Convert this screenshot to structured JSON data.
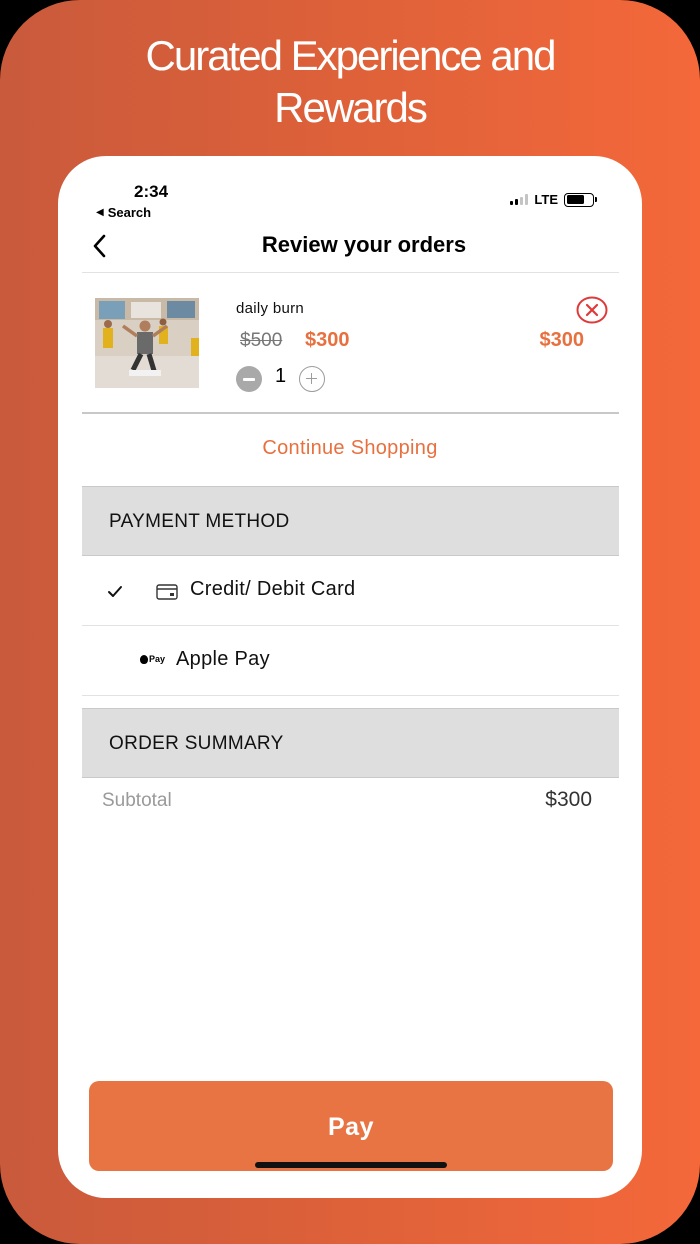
{
  "headline": {
    "line1": "Curated Experience and",
    "line2": "Rewards"
  },
  "status_bar": {
    "time": "2:34",
    "back_app": "Search",
    "network": "LTE"
  },
  "nav": {
    "title": "Review your orders"
  },
  "order_item": {
    "name": "daily burn",
    "original_price": "$500",
    "sale_price": "$300",
    "line_total": "$300",
    "quantity": "1"
  },
  "continue_shopping": "Continue Shopping",
  "payment_method": {
    "header": "PAYMENT METHOD",
    "options": [
      {
        "label": "Credit/ Debit Card",
        "icon": "credit-card-icon",
        "selected": true
      },
      {
        "label": "Apple Pay",
        "icon": "apple-pay-icon",
        "icon_text": "Pay",
        "selected": false
      }
    ]
  },
  "order_summary": {
    "header": "ORDER SUMMARY",
    "subtotal_label": "Subtotal",
    "subtotal_value": "$300"
  },
  "pay_button": "Pay",
  "colors": {
    "accent": "#e8703f",
    "background_gradient_start": "#c95a3c",
    "background_gradient_end": "#f4683a",
    "section_header_bg": "#dedede",
    "remove_icon": "#e0393a"
  }
}
